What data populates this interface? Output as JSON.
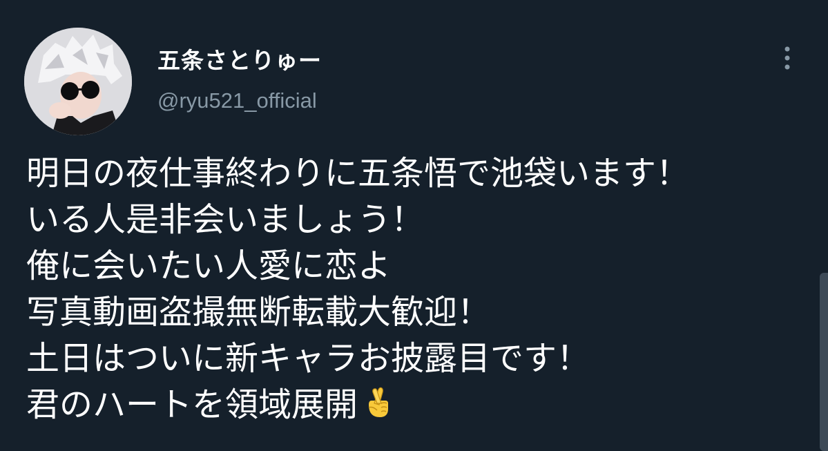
{
  "tweet": {
    "author": {
      "display_name": "五条さとりゅー",
      "handle": "@ryu521_official",
      "avatar_icon": "profile-photo"
    },
    "more_icon": "vertical-ellipsis-icon",
    "lines": [
      "明日の夜仕事終わりに五条悟で池袋います！",
      "いる人是非会いましょう！",
      "俺に会いたい人愛に恋よ",
      "写真動画盗撮無断転載大歓迎！",
      "土日はついに新キャラお披露目です！",
      "君のハートを領域展開"
    ],
    "trailing_emoji": "crossed-fingers-emoji"
  },
  "colors": {
    "background": "#15202b",
    "text_primary": "#ffffff",
    "text_secondary": "#8899a6",
    "scrollbar": "#3d4a57"
  }
}
